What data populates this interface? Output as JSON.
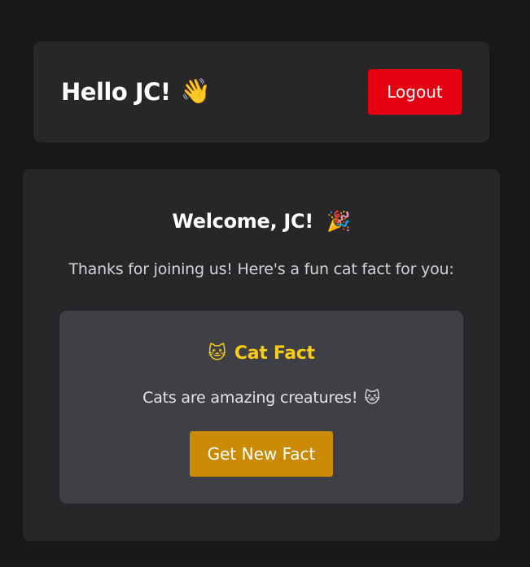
{
  "header": {
    "greeting": "Hello JC!",
    "wave_emoji": "👋",
    "logout_label": "Logout"
  },
  "welcome": {
    "title": "Welcome, JC!",
    "party_emoji": "🎉",
    "intro": "Thanks for joining us! Here's a fun cat fact for you:"
  },
  "cat_fact": {
    "icon_emoji": "🐱",
    "title": "Cat Fact",
    "text": "Cats are amazing creatures!",
    "text_emoji": "🐱",
    "button_label": "Get New Fact"
  },
  "colors": {
    "background": "#18181b",
    "card": "#27272a",
    "fact_card": "#3f3f46",
    "logout": "#e40011",
    "accent_yellow": "#facc15",
    "button_gold": "#ca8a04"
  }
}
